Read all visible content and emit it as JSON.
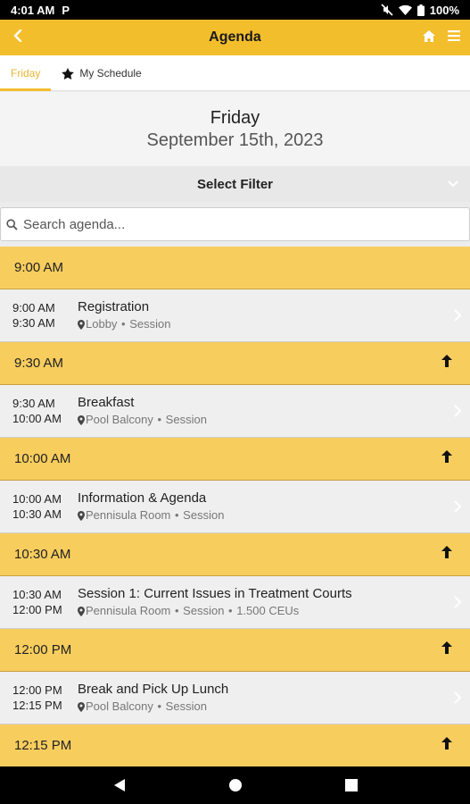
{
  "status_bar": {
    "time": "4:01",
    "ampm": "AM",
    "carrier": "P",
    "battery": "100%"
  },
  "app_bar": {
    "title": "Agenda"
  },
  "tabs": [
    {
      "label": "Friday",
      "active": true
    },
    {
      "label": "My Schedule",
      "active": false
    }
  ],
  "date_header": {
    "day": "Friday",
    "date": "September 15th, 2023"
  },
  "filter": {
    "label": "Select Filter"
  },
  "search": {
    "placeholder": "Search agenda..."
  },
  "agenda": [
    {
      "slot": "9:00 AM",
      "collapsible": false,
      "session": {
        "start": "9:00 AM",
        "end": "9:30 AM",
        "name": "Registration",
        "location": "Lobby",
        "type": "Session",
        "extra": ""
      }
    },
    {
      "slot": "9:30 AM",
      "collapsible": true,
      "session": {
        "start": "9:30 AM",
        "end": "10:00 AM",
        "name": "Breakfast",
        "location": "Pool Balcony",
        "type": "Session",
        "extra": ""
      }
    },
    {
      "slot": "10:00 AM",
      "collapsible": true,
      "session": {
        "start": "10:00 AM",
        "end": "10:30 AM",
        "name": "Information & Agenda",
        "location": "Pennisula Room",
        "type": "Session",
        "extra": ""
      }
    },
    {
      "slot": "10:30 AM",
      "collapsible": true,
      "session": {
        "start": "10:30 AM",
        "end": "12:00 PM",
        "name": "Session 1: Current Issues in Treatment Courts",
        "location": "Pennisula Room",
        "type": "Session",
        "extra": "1.500 CEUs"
      }
    },
    {
      "slot": "12:00 PM",
      "collapsible": true,
      "session": {
        "start": "12:00 PM",
        "end": "12:15 PM",
        "name": "Break and Pick Up Lunch",
        "location": "Pool Balcony",
        "type": "Session",
        "extra": ""
      }
    },
    {
      "slot": "12:15 PM",
      "collapsible": true,
      "session": null
    }
  ],
  "colors": {
    "accent": "#f3be2c",
    "time_header": "#f7cd5e",
    "tab_active": "#e9b431"
  }
}
